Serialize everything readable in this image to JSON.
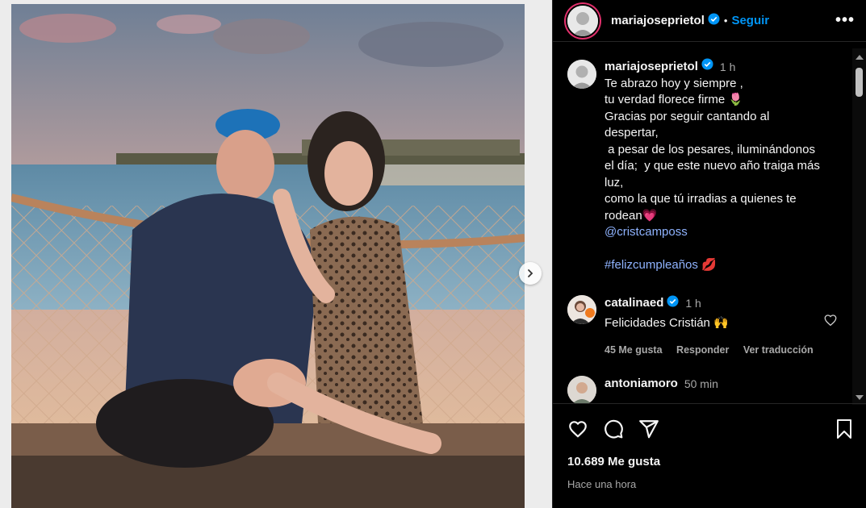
{
  "post": {
    "username": "mariajoseprietol",
    "follow_label": "Seguir",
    "more_label": "•••",
    "separator": "•"
  },
  "caption": {
    "username": "mariajoseprietol",
    "time": "1 h",
    "lines": [
      "Te abrazo hoy y siempre ,",
      "tu verdad florece firme 🌷",
      "Gracias por seguir cantando al",
      "despertar,",
      " a pesar de los pesares, iluminándonos",
      "el día;  y que este nuevo año traiga más",
      "luz,",
      "como la que tú irradias a quienes te",
      "rodean💗"
    ],
    "mention": "@cristcamposs",
    "hashtag": "#felizcumpleaños 💋"
  },
  "comments": [
    {
      "username": "catalinaed",
      "time": "1 h",
      "text": "Felicidades Cristián 🙌",
      "likes": "45 Me gusta",
      "reply": "Responder",
      "translate": "Ver traducción"
    },
    {
      "username": "antoniamoro",
      "time": "50 min"
    }
  ],
  "footer": {
    "likes": "10.689 Me gusta",
    "ago": "Hace una hora"
  },
  "icons": {
    "like": "heart-icon",
    "comment": "comment-icon",
    "share": "share-icon",
    "save": "bookmark-icon",
    "next": "chevron-right-icon",
    "verified": "verified-badge-icon"
  },
  "colors": {
    "accent": "#0095f6",
    "verified": "#0095f6",
    "link": "#8fb3ff",
    "muted": "#a8a8a8",
    "background": "#000000"
  }
}
